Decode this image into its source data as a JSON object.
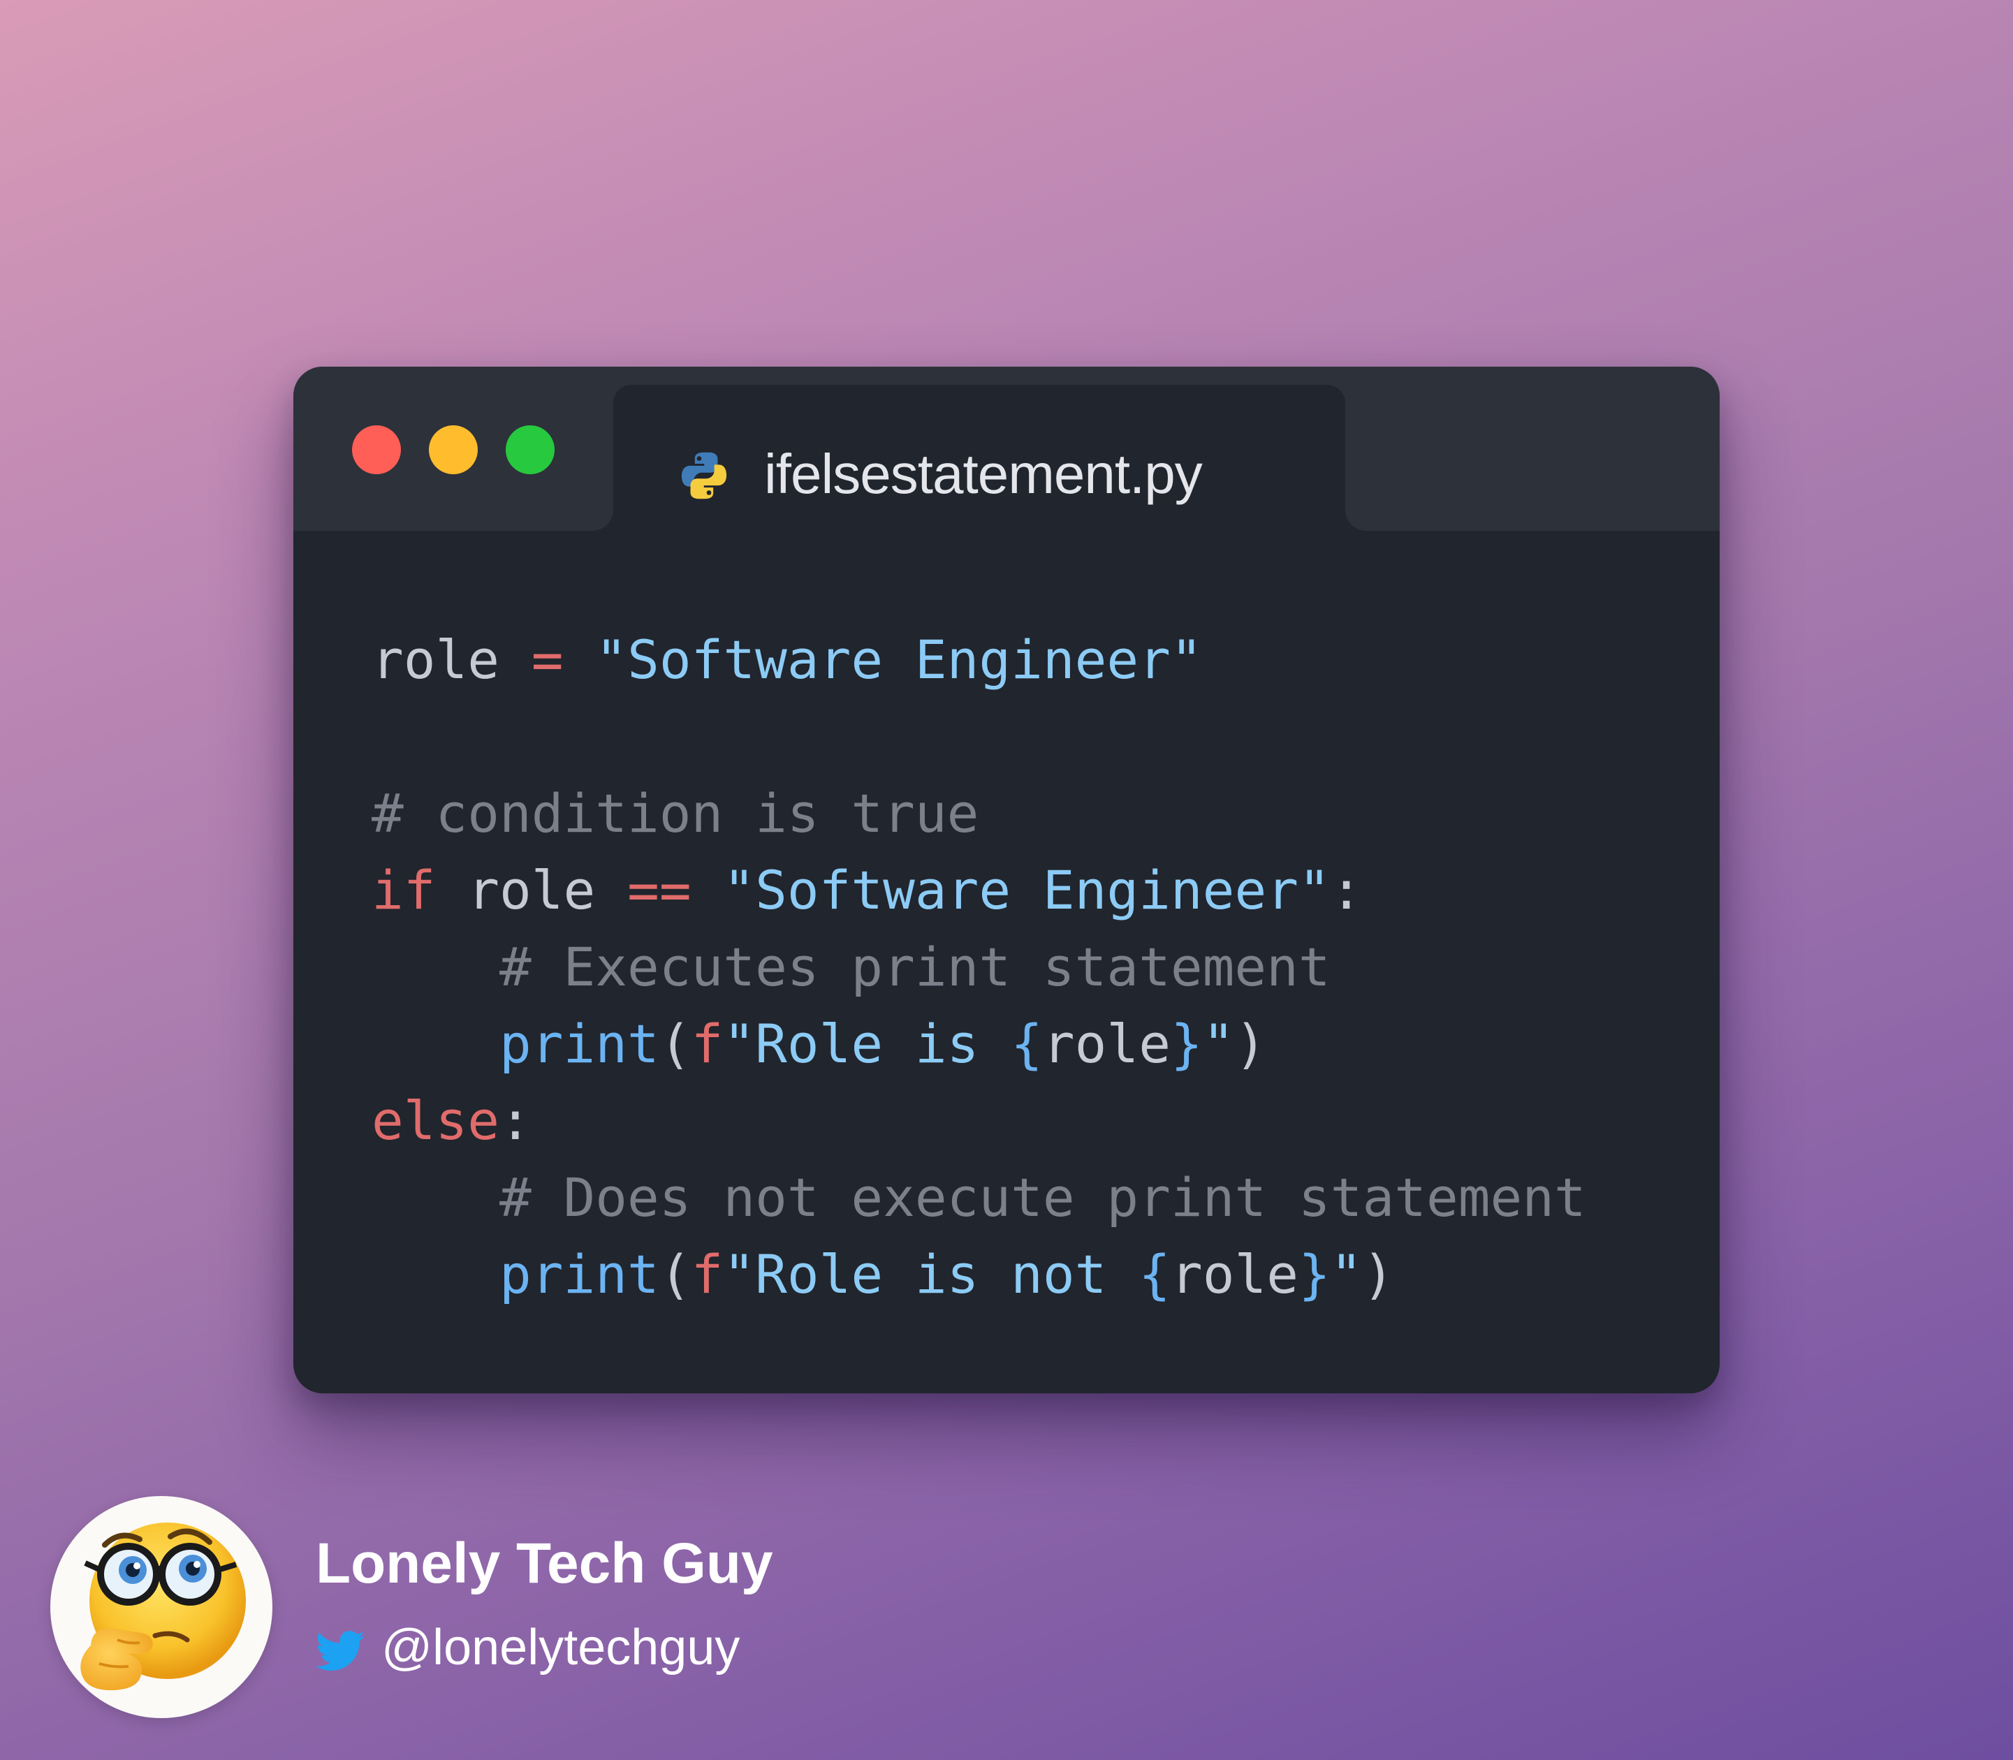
{
  "window": {
    "tab_title": "ifelsestatement.py",
    "tab_icon": "python-icon",
    "controls": [
      "close",
      "minimize",
      "maximize"
    ]
  },
  "code": {
    "language": "python",
    "lines": [
      [
        {
          "t": "role",
          "k": "var"
        },
        {
          "t": " ",
          "k": "var"
        },
        {
          "t": "=",
          "k": "op"
        },
        {
          "t": " ",
          "k": "var"
        },
        {
          "t": "\"Software Engineer\"",
          "k": "str"
        }
      ],
      [],
      [
        {
          "t": "# condition is true",
          "k": "comment"
        }
      ],
      [
        {
          "t": "if",
          "k": "kw"
        },
        {
          "t": " role ",
          "k": "var"
        },
        {
          "t": "==",
          "k": "op"
        },
        {
          "t": " ",
          "k": "var"
        },
        {
          "t": "\"Software Engineer\"",
          "k": "str"
        },
        {
          "t": ":",
          "k": "punct"
        }
      ],
      [
        {
          "t": "    ",
          "k": "var"
        },
        {
          "t": "# Executes print statement",
          "k": "comment"
        }
      ],
      [
        {
          "t": "    ",
          "k": "var"
        },
        {
          "t": "print",
          "k": "fn"
        },
        {
          "t": "(",
          "k": "punct"
        },
        {
          "t": "f",
          "k": "fprefix"
        },
        {
          "t": "\"Role is ",
          "k": "str"
        },
        {
          "t": "{",
          "k": "brace"
        },
        {
          "t": "role",
          "k": "var"
        },
        {
          "t": "}",
          "k": "brace"
        },
        {
          "t": "\"",
          "k": "str"
        },
        {
          "t": ")",
          "k": "punct"
        }
      ],
      [
        {
          "t": "else",
          "k": "kw"
        },
        {
          "t": ":",
          "k": "punct"
        }
      ],
      [
        {
          "t": "    ",
          "k": "var"
        },
        {
          "t": "# Does not execute print statement",
          "k": "comment"
        }
      ],
      [
        {
          "t": "    ",
          "k": "var"
        },
        {
          "t": "print",
          "k": "fn"
        },
        {
          "t": "(",
          "k": "punct"
        },
        {
          "t": "f",
          "k": "fprefix"
        },
        {
          "t": "\"Role is not ",
          "k": "str"
        },
        {
          "t": "{",
          "k": "brace"
        },
        {
          "t": "role",
          "k": "var"
        },
        {
          "t": "}",
          "k": "brace"
        },
        {
          "t": "\"",
          "k": "str"
        },
        {
          "t": ")",
          "k": "punct"
        }
      ]
    ]
  },
  "author": {
    "name": "Lonely Tech Guy",
    "handle": "@lonelytechguy",
    "avatar_icon": "thinking-nerd-emoji-icon",
    "social_icon": "twitter-icon"
  },
  "colors": {
    "window_bg": "#21252d",
    "titlebar_bg": "#2d3139",
    "close": "#ff5f56",
    "minimize": "#ffbd2e",
    "maximize": "#27c93f",
    "keyword": "#e06c6b",
    "string": "#8ccbf5",
    "comment": "#7b818b",
    "function": "#6cb3f2",
    "twitter": "#1da1f2"
  }
}
